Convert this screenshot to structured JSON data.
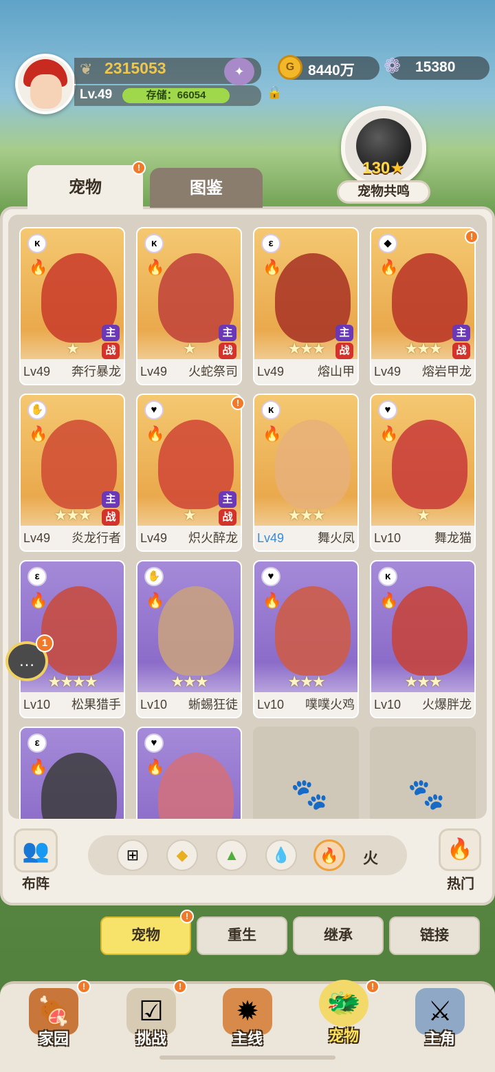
{
  "player": {
    "power": "2315053",
    "level": "Lv.49",
    "storage": "存储：66054"
  },
  "currency": {
    "gold": "8440万",
    "gems": "15380"
  },
  "resonance": {
    "count": "130",
    "label": "宠物共鸣"
  },
  "tabs": {
    "pets": "宠物",
    "codex": "图鉴"
  },
  "pets": [
    {
      "level": "Lv49",
      "name": "奔行暴龙",
      "stars": "★",
      "badges": true,
      "style": "gold",
      "elem": "κ",
      "color": "#c93a2a"
    },
    {
      "level": "Lv49",
      "name": "火蛇祭司",
      "stars": "★",
      "badges": true,
      "style": "gold",
      "elem": "κ",
      "color": "#c0413a"
    },
    {
      "level": "Lv49",
      "name": "熔山甲",
      "stars": "★★★",
      "badges": true,
      "style": "gold",
      "elem": "ε",
      "color": "#a73125"
    },
    {
      "level": "Lv49",
      "name": "熔岩甲龙",
      "stars": "★★★",
      "badges": true,
      "style": "gold",
      "elem": "◆",
      "color": "#b83227"
    },
    {
      "level": "Lv49",
      "name": "炎龙行者",
      "stars": "★★★",
      "badges": true,
      "style": "gold",
      "elem": "✋",
      "color": "#cf4a34"
    },
    {
      "level": "Lv49",
      "name": "炽火醉龙",
      "stars": "★",
      "badges": true,
      "style": "gold",
      "elem": "♥",
      "color": "#d04535"
    },
    {
      "level": "Lv49",
      "name": "舞火凤",
      "stars": "★★★",
      "badges": false,
      "style": "gold",
      "elem": "κ",
      "color": "#e8b07a",
      "blue": true
    },
    {
      "level": "Lv10",
      "name": "舞龙猫",
      "stars": "★",
      "badges": false,
      "style": "gold",
      "elem": "♥",
      "color": "#c83a3a"
    },
    {
      "level": "Lv10",
      "name": "松果猎手",
      "stars": "★★★★",
      "badges": false,
      "style": "purple",
      "elem": "ε",
      "color": "#c94a3a"
    },
    {
      "level": "Lv10",
      "name": "蜥蜴狂徒",
      "stars": "★★★",
      "badges": false,
      "style": "purple",
      "elem": "✋",
      "color": "#caa27c"
    },
    {
      "level": "Lv10",
      "name": "噗噗火鸡",
      "stars": "★★★",
      "badges": false,
      "style": "purple",
      "elem": "♥",
      "color": "#d05a42"
    },
    {
      "level": "Lv10",
      "name": "火爆胖龙",
      "stars": "★★★",
      "badges": false,
      "style": "purple",
      "elem": "κ",
      "color": "#c84236"
    },
    {
      "level": "",
      "name": "",
      "stars": "",
      "badges": false,
      "style": "purple",
      "elem": "ε",
      "color": "#3c3c3c"
    },
    {
      "level": "",
      "name": "",
      "stars": "",
      "badges": false,
      "style": "purple",
      "elem": "♥",
      "color": "#d4707a"
    }
  ],
  "badge_labels": {
    "main": "主",
    "battle": "战"
  },
  "filter": {
    "formation": "布阵",
    "selected_element": "火",
    "hot": "热门"
  },
  "chat_unread": "1",
  "subtabs": [
    "宠物",
    "重生",
    "继承",
    "链接"
  ],
  "nav": [
    "家园",
    "挑战",
    "主线",
    "宠物",
    "主角"
  ]
}
